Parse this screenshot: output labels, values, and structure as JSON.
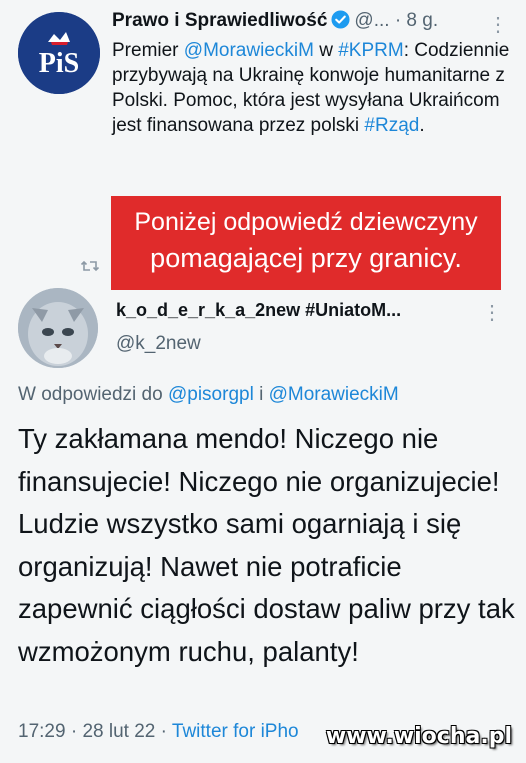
{
  "top_tweet": {
    "display_name": "Prawo i Sprawiedliwość",
    "handle_truncated": "@...",
    "separator": "·",
    "time_ago": "8 g.",
    "more": "⋮",
    "avatar_text": "PiS",
    "segments": [
      {
        "text": "Premier ",
        "link": false
      },
      {
        "text": "@MorawieckiM",
        "link": true
      },
      {
        "text": " w ",
        "link": false
      },
      {
        "text": "#KPRM",
        "link": true
      },
      {
        "text": ": Codziennie przybywają na Ukrainę konwoje humanitarne z Polski. Pomoc, która jest wysyłana Ukraińcom jest finansowana przez polski ",
        "link": false
      },
      {
        "text": "#Rząd",
        "link": true
      },
      {
        "text": ".",
        "link": false
      }
    ]
  },
  "banner": {
    "line1": "Poniżej odpowiedź dziewczyny",
    "line2": "pomagającej przy granicy."
  },
  "reply_tweet": {
    "display_name": "k_o_d_e_r_k_a_2new #UniatoM...",
    "handle": "@k_2new",
    "more": "⋮",
    "reply_prefix": "W odpowiedzi do ",
    "reply_to_1": "@pisorgpl",
    "reply_joiner": " i ",
    "reply_to_2": "@MorawieckiM",
    "text": "Ty zakłamana mendo! Niczego nie finansujecie! Niczego nie organizujecie! Ludzie wszystko sami ogarniają i się organizują! Nawet nie potraficie zapewnić ciągłości dostaw paliw przy tak wzmożonym ruchu, palanty!",
    "time": "17:29",
    "sep1": "·",
    "date": "28 lut 22",
    "sep2": "·",
    "source": "Twitter for iPho"
  },
  "watermark": "www.wiocha.pl",
  "colors": {
    "link": "#1d87d8",
    "banner": "#e02b2b",
    "pis_blue": "#1b3c86",
    "verified": "#1d9bf0"
  }
}
